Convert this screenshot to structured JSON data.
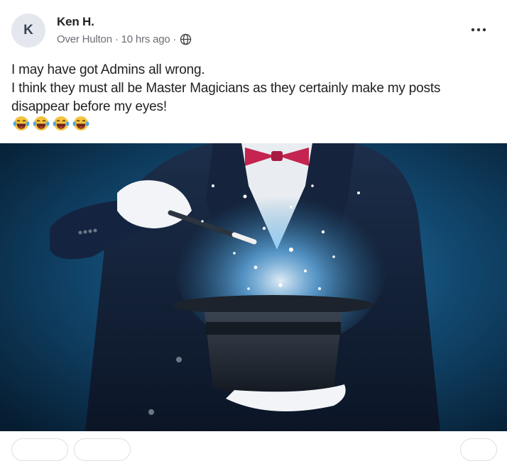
{
  "post": {
    "author": {
      "initial": "K",
      "name": "Ken H."
    },
    "meta": {
      "neighborhood": "Over Hulton",
      "separator": "·",
      "time": "10 hrs ago",
      "visibility_icon": "globe-icon"
    },
    "menu_icon": "more-horizontal-icon",
    "body_lines": [
      "I may have got Admins all wrong.",
      "I think they must all be Master Magicians as they certainly make my posts",
      "disappear before my eyes!"
    ],
    "emoji": {
      "name": "laughing-tears-emoji",
      "count": 4
    },
    "image": {
      "subject": "magician-hat-wand-photo"
    }
  },
  "colors": {
    "avatar_bg": "#e4e7ee",
    "text": "#222222",
    "meta_text": "#6b6f76",
    "bow_tie": "#c4244f",
    "photo_bg": "#0e3a5c"
  }
}
